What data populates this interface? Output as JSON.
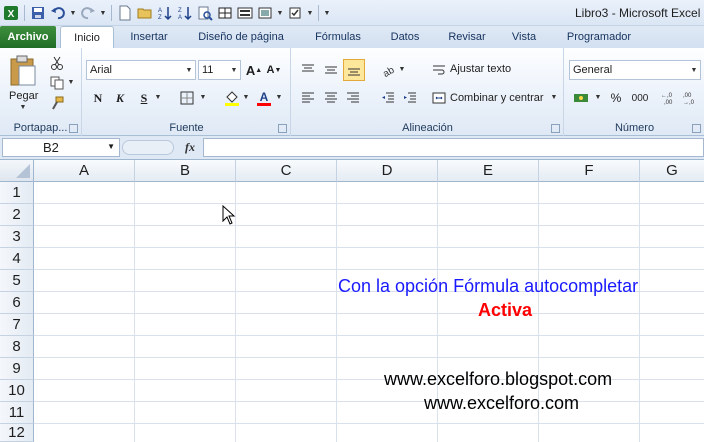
{
  "window": {
    "title": "Libro3 - Microsoft Excel"
  },
  "tabs": [
    {
      "label": "Archivo"
    },
    {
      "label": "Inicio"
    },
    {
      "label": "Insertar"
    },
    {
      "label": "Diseño de página"
    },
    {
      "label": "Fórmulas"
    },
    {
      "label": "Datos"
    },
    {
      "label": "Revisar"
    },
    {
      "label": "Vista"
    },
    {
      "label": "Programador"
    }
  ],
  "ribbon": {
    "clipboard": {
      "label": "Portapap...",
      "paste_label": "Pegar"
    },
    "font": {
      "label": "Fuente",
      "font_name": "Arial",
      "font_size": "11",
      "bold": "N",
      "italic": "K",
      "underline": "S"
    },
    "alignment": {
      "label": "Alineación",
      "wrap_text": "Ajustar texto",
      "merge_center": "Combinar y centrar"
    },
    "number": {
      "label": "Número",
      "format": "General",
      "percent": "%",
      "thousands": "000"
    }
  },
  "formula_bar": {
    "name_box": "B2",
    "fx_label": "fx",
    "content": ""
  },
  "sheet": {
    "columns": [
      "A",
      "B",
      "C",
      "D",
      "E",
      "F",
      "G"
    ],
    "rows": [
      "1",
      "2",
      "3",
      "4",
      "5",
      "6",
      "7",
      "8",
      "9",
      "10",
      "11",
      "12"
    ],
    "selected_cell": "B2"
  },
  "annotations": {
    "line1": "Con la opción Fórmula autocompletar",
    "line2": "Activa",
    "line3": "www.excelforo.blogspot.com",
    "line4": "www.excelforo.com"
  },
  "colors": {
    "file_tab": "#1f6e26",
    "note_blue": "#1a1aff",
    "note_red": "#ff0000"
  }
}
